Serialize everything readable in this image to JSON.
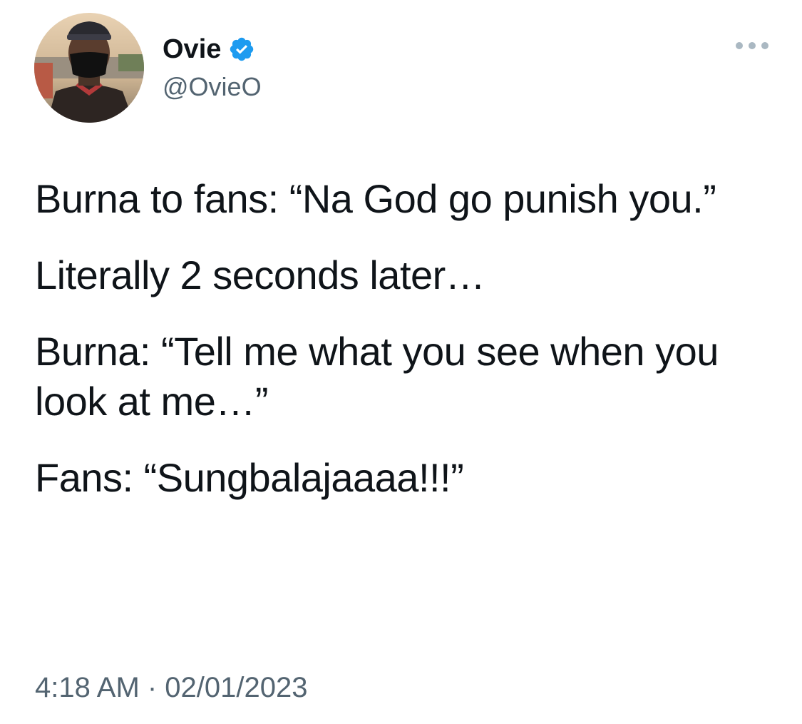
{
  "author": {
    "display_name": "Ovie",
    "handle": "@OvieO",
    "verified": true,
    "avatar_icon": "avatar-photo-icon",
    "verified_icon": "verified-badge-icon",
    "verified_color": "#1d9bf0"
  },
  "menu": {
    "icon": "more-options-icon"
  },
  "tweet": {
    "paragraphs": [
      "Burna to fans: “Na God go punish you.”",
      "Literally 2 seconds later…",
      "Burna: “Tell me what you see when you look at me…”",
      "Fans: “Sungbalajaaaa!!!”"
    ],
    "timestamp": "4:18 AM · 02/01/2023"
  },
  "colors": {
    "text": "#0f1419",
    "secondary": "#536471",
    "background": "#ffffff"
  }
}
